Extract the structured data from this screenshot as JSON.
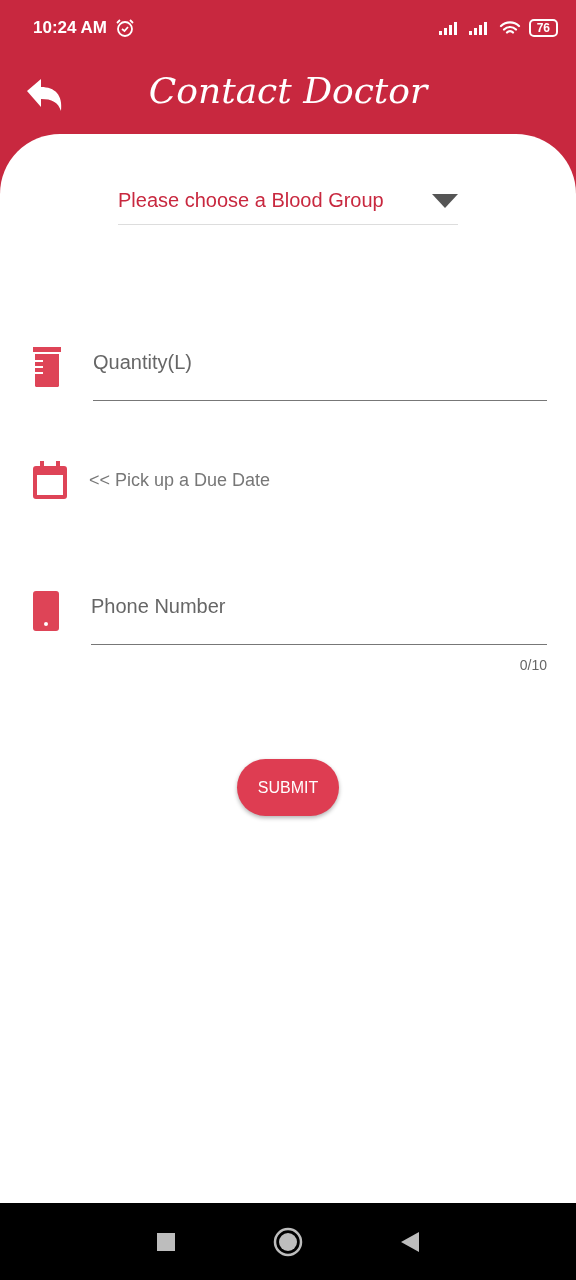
{
  "status_bar": {
    "time": "10:24 AM",
    "battery": "76"
  },
  "header": {
    "title": "Contact Doctor"
  },
  "blood_group": {
    "placeholder": "Please choose a Blood Group"
  },
  "quantity": {
    "placeholder": "Quantity(L)"
  },
  "due_date": {
    "label": "<< Pick up a Due Date"
  },
  "phone": {
    "placeholder": "Phone Number",
    "counter": "0/10"
  },
  "submit": {
    "label": "SUBMIT"
  }
}
